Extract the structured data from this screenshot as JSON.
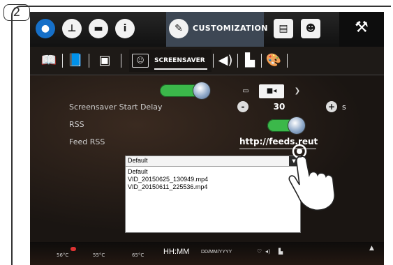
{
  "step_badge": "2",
  "top_bar": {
    "customization_label": "CUSTOMIZATION",
    "icons": [
      "water-drop-icon",
      "temperature-icon",
      "flag-icon",
      "info-icon",
      "pencil-icon",
      "display-icon",
      "person-icon",
      "wrench-icon"
    ]
  },
  "sub_bar": {
    "screensaver_label": "SCREENSAVER",
    "icons": [
      "book-icon",
      "book-color-icon",
      "image-icon",
      "screensaver-icon",
      "speaker-icon",
      "brightness-icon",
      "palette-icon"
    ]
  },
  "settings": {
    "screensaver_enabled": true,
    "start_delay": {
      "label": "Screensaver Start Delay",
      "value": "30",
      "unit": "s",
      "minus": "-",
      "plus": "+"
    },
    "rss": {
      "label": "RSS",
      "enabled": true
    },
    "feed_rss": {
      "label": "Feed RSS",
      "value": "http://feeds.reut"
    },
    "screensaver_mode_selected": "video"
  },
  "dropdown": {
    "selected": "Default",
    "options": [
      "Default",
      "VID_20150625_130949.mp4",
      "VID_20150611_225536.mp4"
    ]
  },
  "status_bar": {
    "time": "HH:MM",
    "date": "DD/MM/YYYY",
    "temps": [
      "56°C",
      "55°C",
      "65°C"
    ]
  },
  "colors": {
    "toggle_on": "#3bb84a",
    "active_tab": "#3d4754",
    "water_icon": "#1670c9"
  }
}
